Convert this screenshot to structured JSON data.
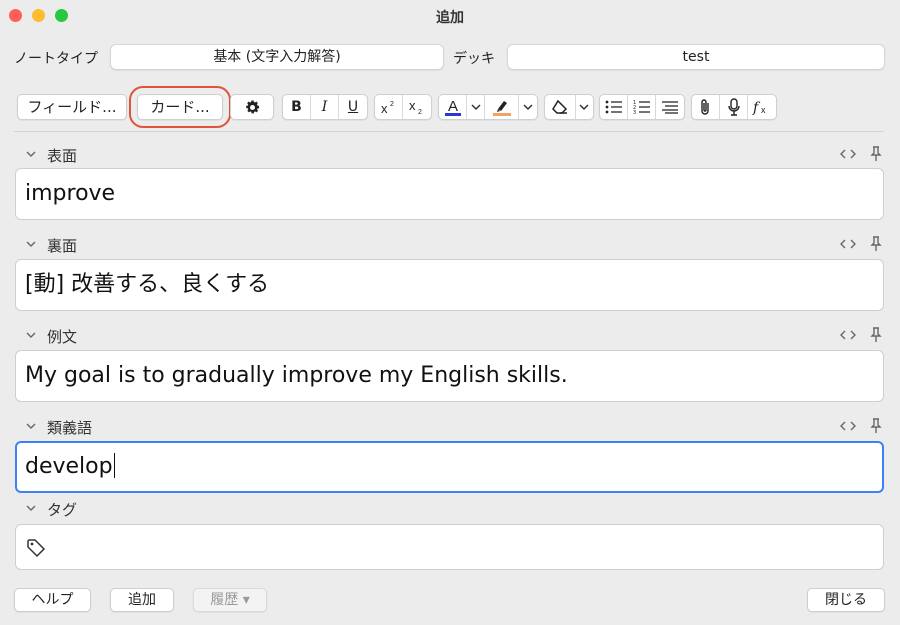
{
  "window": {
    "title": "追加"
  },
  "header": {
    "notetype_label": "ノートタイプ",
    "notetype_value": "基本 (文字入力解答)",
    "deck_label": "デッキ",
    "deck_value": "test"
  },
  "toolbar": {
    "fields_label": "フィールド...",
    "cards_label": "カード...",
    "icons": [
      "gear-icon",
      "bold-icon",
      "italic-icon",
      "underline-icon",
      "superscript-icon",
      "subscript-icon",
      "text-color-icon",
      "highlight-icon",
      "eraser-icon",
      "bullet-list-icon",
      "numbered-list-icon",
      "align-icon",
      "paperclip-icon",
      "microphone-icon",
      "function-icon"
    ],
    "bold": "B",
    "italic": "I",
    "underline": "U",
    "text_color": "#2a36d9",
    "highlight_color": "#f4a261"
  },
  "fields": [
    {
      "name": "表面",
      "value": "improve",
      "focused": false
    },
    {
      "name": "裏面",
      "value": "[動] 改善する、良くする",
      "focused": false
    },
    {
      "name": "例文",
      "value": "My goal is to gradually improve my English skills.",
      "focused": false
    },
    {
      "name": "類義語",
      "value": "develop",
      "focused": true
    }
  ],
  "tags": {
    "label": "タグ"
  },
  "footer": {
    "help_label": "ヘルプ",
    "add_label": "追加",
    "history_label": "履歴 ▾",
    "close_label": "閉じる"
  },
  "colors": {
    "accent": "#3b82f6",
    "highlight_ring": "#e0523a"
  }
}
